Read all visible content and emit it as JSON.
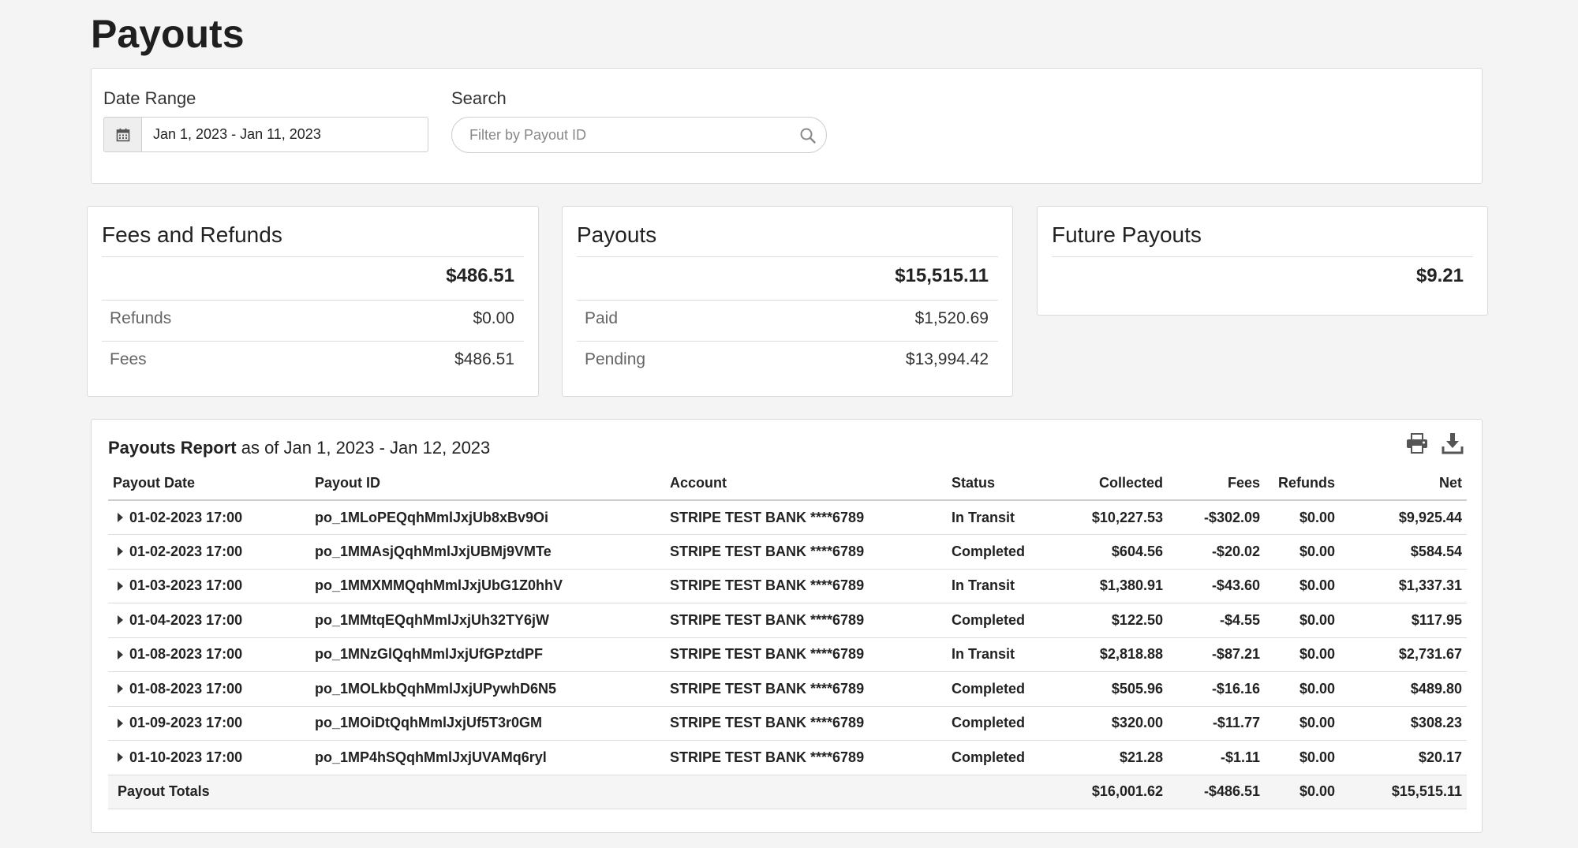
{
  "page": {
    "title": "Payouts"
  },
  "filters": {
    "date_range_label": "Date Range",
    "date_range_value": "Jan 1, 2023 - Jan 11, 2023",
    "search_label": "Search",
    "search_placeholder": "Filter by Payout ID",
    "search_value": ""
  },
  "cards": {
    "fees_refunds": {
      "title": "Fees and Refunds",
      "total": "$486.51",
      "rows": [
        {
          "label": "Refunds",
          "value": "$0.00"
        },
        {
          "label": "Fees",
          "value": "$486.51"
        }
      ]
    },
    "payouts": {
      "title": "Payouts",
      "total": "$15,515.11",
      "rows": [
        {
          "label": "Paid",
          "value": "$1,520.69"
        },
        {
          "label": "Pending",
          "value": "$13,994.42"
        }
      ]
    },
    "future_payouts": {
      "title": "Future Payouts",
      "total": "$9.21"
    }
  },
  "report": {
    "title": "Payouts Report",
    "subtitle": "as of Jan 1, 2023 - Jan 12, 2023",
    "icons": {
      "print": "print-icon",
      "download": "download-icon"
    },
    "columns": {
      "payout_date": "Payout Date",
      "payout_id": "Payout ID",
      "account": "Account",
      "status": "Status",
      "collected": "Collected",
      "fees": "Fees",
      "refunds": "Refunds",
      "net": "Net"
    },
    "rows": [
      {
        "date": "01-02-2023 17:00",
        "id": "po_1MLoPEQqhMmlJxjUb8xBv9Oi",
        "account": "STRIPE TEST BANK ****6789",
        "status": "In Transit",
        "collected": "$10,227.53",
        "fees": "-$302.09",
        "refunds": "$0.00",
        "net": "$9,925.44"
      },
      {
        "date": "01-02-2023 17:00",
        "id": "po_1MMAsjQqhMmlJxjUBMj9VMTe",
        "account": "STRIPE TEST BANK ****6789",
        "status": "Completed",
        "collected": "$604.56",
        "fees": "-$20.02",
        "refunds": "$0.00",
        "net": "$584.54"
      },
      {
        "date": "01-03-2023 17:00",
        "id": "po_1MMXMMQqhMmlJxjUbG1Z0hhV",
        "account": "STRIPE TEST BANK ****6789",
        "status": "In Transit",
        "collected": "$1,380.91",
        "fees": "-$43.60",
        "refunds": "$0.00",
        "net": "$1,337.31"
      },
      {
        "date": "01-04-2023 17:00",
        "id": "po_1MMtqEQqhMmlJxjUh32TY6jW",
        "account": "STRIPE TEST BANK ****6789",
        "status": "Completed",
        "collected": "$122.50",
        "fees": "-$4.55",
        "refunds": "$0.00",
        "net": "$117.95"
      },
      {
        "date": "01-08-2023 17:00",
        "id": "po_1MNzGlQqhMmlJxjUfGPztdPF",
        "account": "STRIPE TEST BANK ****6789",
        "status": "In Transit",
        "collected": "$2,818.88",
        "fees": "-$87.21",
        "refunds": "$0.00",
        "net": "$2,731.67"
      },
      {
        "date": "01-08-2023 17:00",
        "id": "po_1MOLkbQqhMmlJxjUPywhD6N5",
        "account": "STRIPE TEST BANK ****6789",
        "status": "Completed",
        "collected": "$505.96",
        "fees": "-$16.16",
        "refunds": "$0.00",
        "net": "$489.80"
      },
      {
        "date": "01-09-2023 17:00",
        "id": "po_1MOiDtQqhMmlJxjUf5T3r0GM",
        "account": "STRIPE TEST BANK ****6789",
        "status": "Completed",
        "collected": "$320.00",
        "fees": "-$11.77",
        "refunds": "$0.00",
        "net": "$308.23"
      },
      {
        "date": "01-10-2023 17:00",
        "id": "po_1MP4hSQqhMmlJxjUVAMq6ryl",
        "account": "STRIPE TEST BANK ****6789",
        "status": "Completed",
        "collected": "$21.28",
        "fees": "-$1.11",
        "refunds": "$0.00",
        "net": "$20.17"
      }
    ],
    "totals": {
      "label": "Payout Totals",
      "collected": "$16,001.62",
      "fees": "-$486.51",
      "refunds": "$0.00",
      "net": "$15,515.11"
    }
  }
}
